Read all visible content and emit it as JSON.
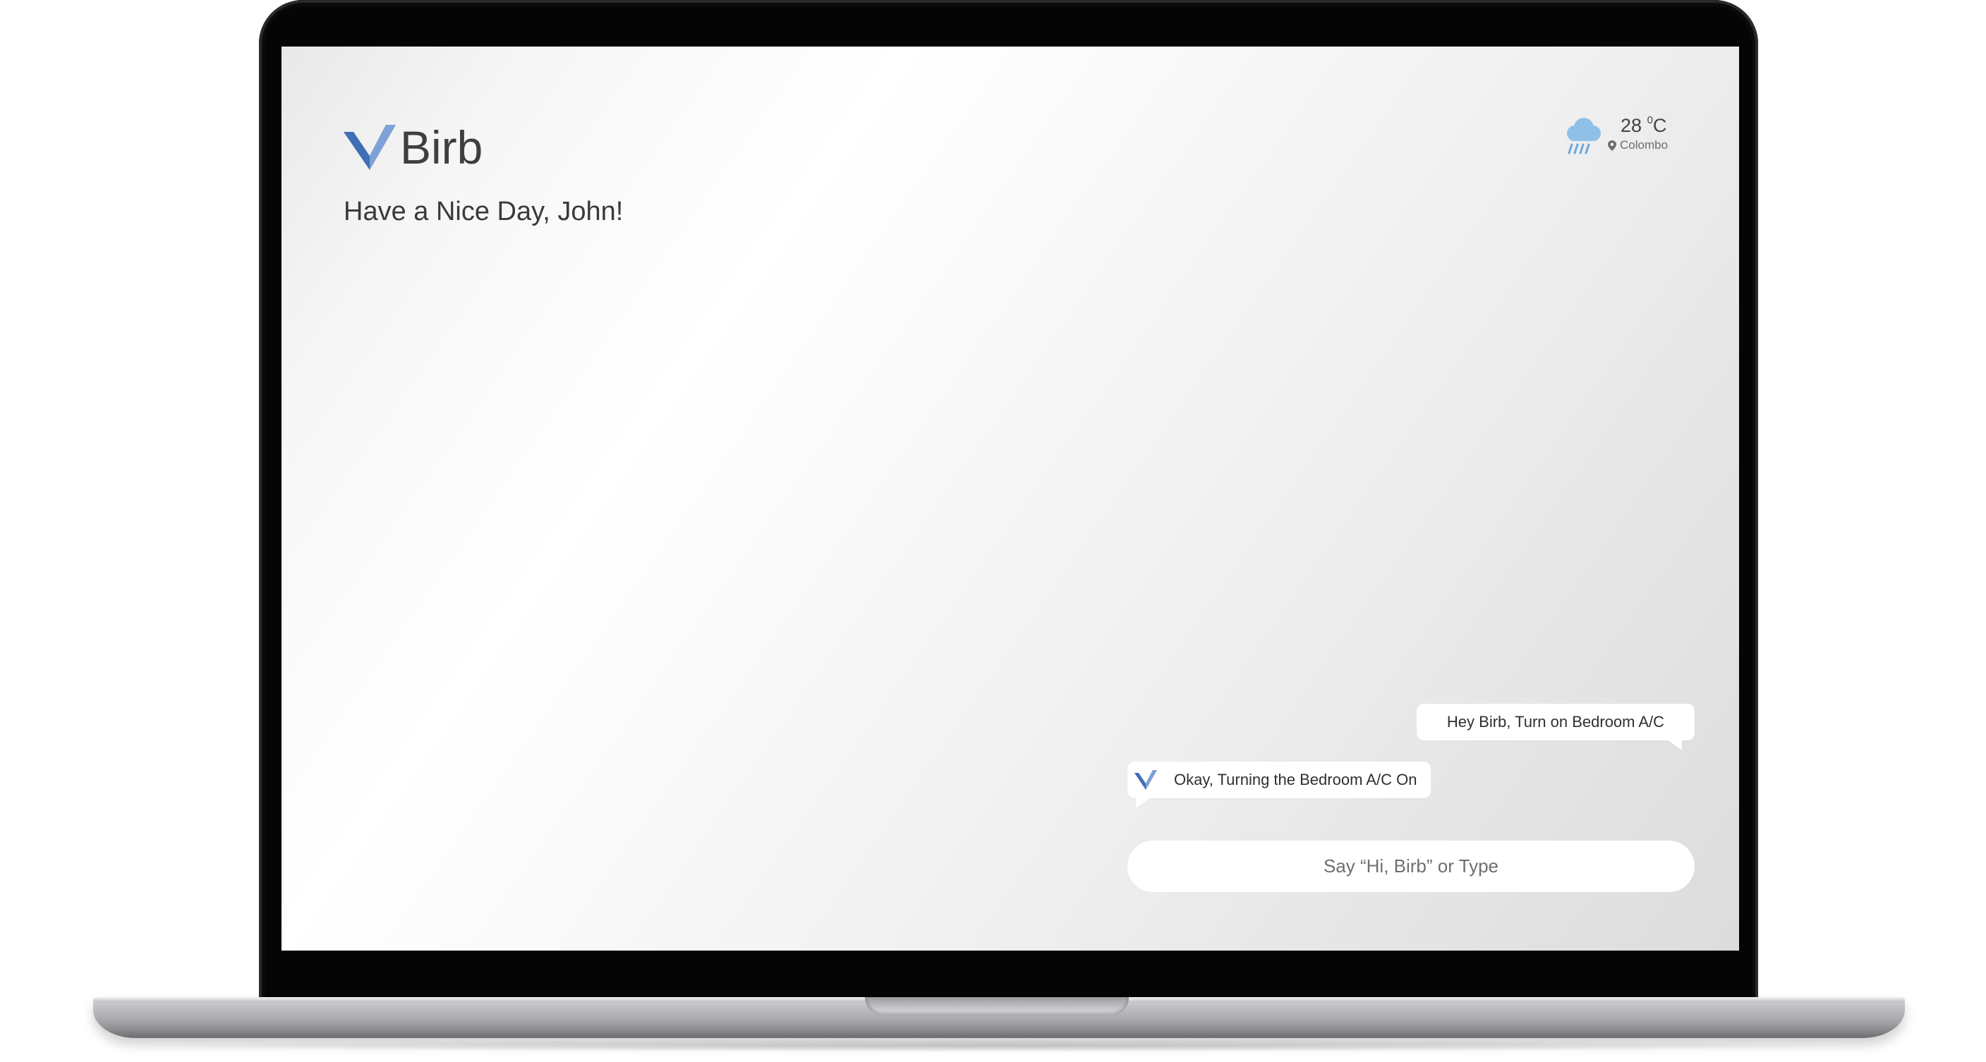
{
  "app": {
    "name": "Birb",
    "logo_icon": "birb-check-logo-icon",
    "brand_color": "#3f6fb5",
    "brand_color_light": "#7fa2d6"
  },
  "greeting": "Have a Nice Day, John!",
  "weather": {
    "temperature": "28",
    "unit": "°C",
    "unit_degree": "0",
    "unit_letter": "C",
    "location": "Colombo",
    "icon": "rain-cloud-icon",
    "icon_color": "#7fb6e3"
  },
  "chat": {
    "messages": [
      {
        "sender": "user",
        "text": "Hey Birb, Turn on Bedroom A/C"
      },
      {
        "sender": "assistant",
        "text": "Okay, Turning the Bedroom A/C On",
        "icon": "birb-check-icon"
      }
    ],
    "input": {
      "value": "",
      "placeholder": "Say “Hi, Birb” or Type"
    }
  }
}
